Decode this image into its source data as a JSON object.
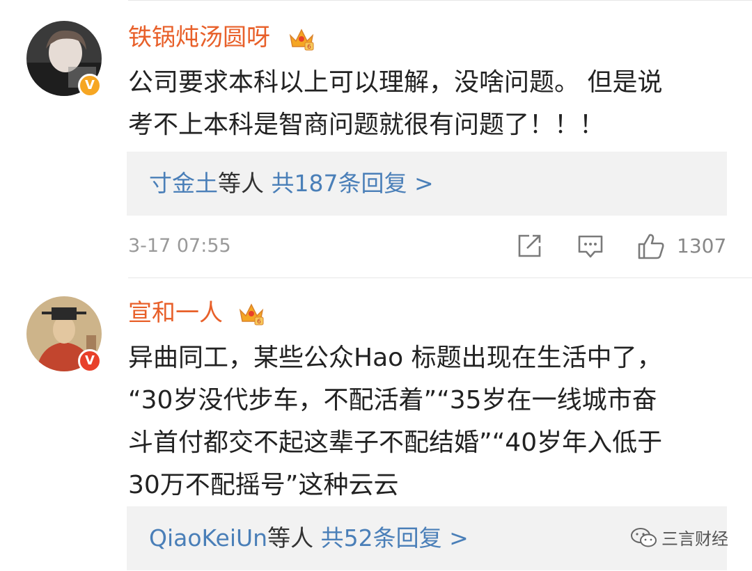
{
  "comments": [
    {
      "username": "铁锅炖汤圆呀",
      "text_lines": [
        "公司要求本科以上可以理解，没啥问题。 但是说",
        "考不上本科是智商问题就很有问题了！！！"
      ],
      "reply_users": "寸金土",
      "reply_mid": "等人 ",
      "reply_count": "共187条回复 >",
      "timestamp": "3-17 07:55",
      "likes": "1307"
    },
    {
      "username": "宣和一人",
      "text_lines": [
        "异曲同工，某些公众Hao 标题出现在生活中了，",
        "“30岁没代步车，不配活着”“35岁在一线城市奋",
        "斗首付都交不起这辈子不配结婚”“40岁年入低于",
        "30万不配摇号”这种云云"
      ],
      "reply_users": "QiaoKeiUn",
      "reply_mid": "等人 ",
      "reply_count": "共52条回复 >"
    }
  ],
  "verified_badge": "V",
  "watermark": "三言财经",
  "colors": {
    "username": "#e8602a",
    "link": "#4a7fb8",
    "badge": "#f6a623"
  }
}
